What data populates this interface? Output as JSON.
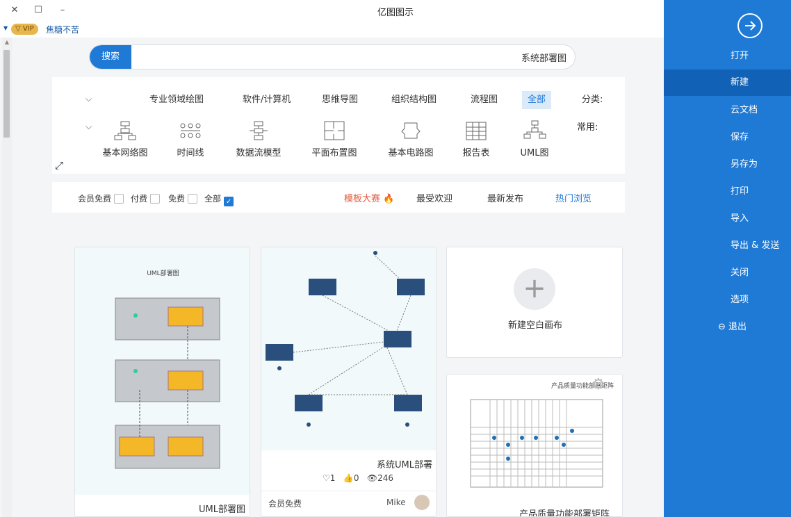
{
  "window": {
    "title": "亿图图示",
    "controls": [
      "✕",
      "☐",
      "–"
    ]
  },
  "account": {
    "vip": "VIP",
    "username": "焦糖不苦"
  },
  "search": {
    "button": "搜索",
    "value": "系统部署图"
  },
  "categories": {
    "label": "分类:",
    "items": [
      "全部",
      "流程图",
      "组织结构图",
      "思维导图",
      "软件/计算机",
      "专业领域绘图"
    ],
    "active": "全部"
  },
  "common": {
    "label": "常用:",
    "items": [
      "UML图",
      "报告表",
      "基本电路图",
      "平面布置图",
      "数据流模型",
      "时间线",
      "基本网络图"
    ]
  },
  "filters": {
    "tabs": [
      "热门浏览",
      "最新发布",
      "最受欢迎",
      "模板大赛"
    ],
    "checks": [
      "全部",
      "免费",
      "付费",
      "会员免费"
    ]
  },
  "cards": {
    "new_blank": "新建空白画布",
    "uml_deploy": {
      "title": "UML部署图",
      "inner_title": "UML部署图"
    },
    "system_uml": {
      "title": "系统UML部署",
      "views": "246",
      "likes": "0",
      "favs": "1",
      "author": "Mike",
      "badge": "会员免费"
    },
    "matrix": {
      "title": "产品质量功能部署矩阵",
      "inner_title": "产品质量功能部署矩阵"
    }
  },
  "sidebar": {
    "items": [
      "打开",
      "新建",
      "云文档",
      "保存",
      "另存为",
      "打印",
      "导入",
      "导出 & 发送",
      "关闭",
      "选项",
      "退出"
    ],
    "active": "新建"
  },
  "colors": {
    "accent": "#1f7ad6",
    "sidebar": "#1f7ad6",
    "hot": "#e2583e"
  }
}
